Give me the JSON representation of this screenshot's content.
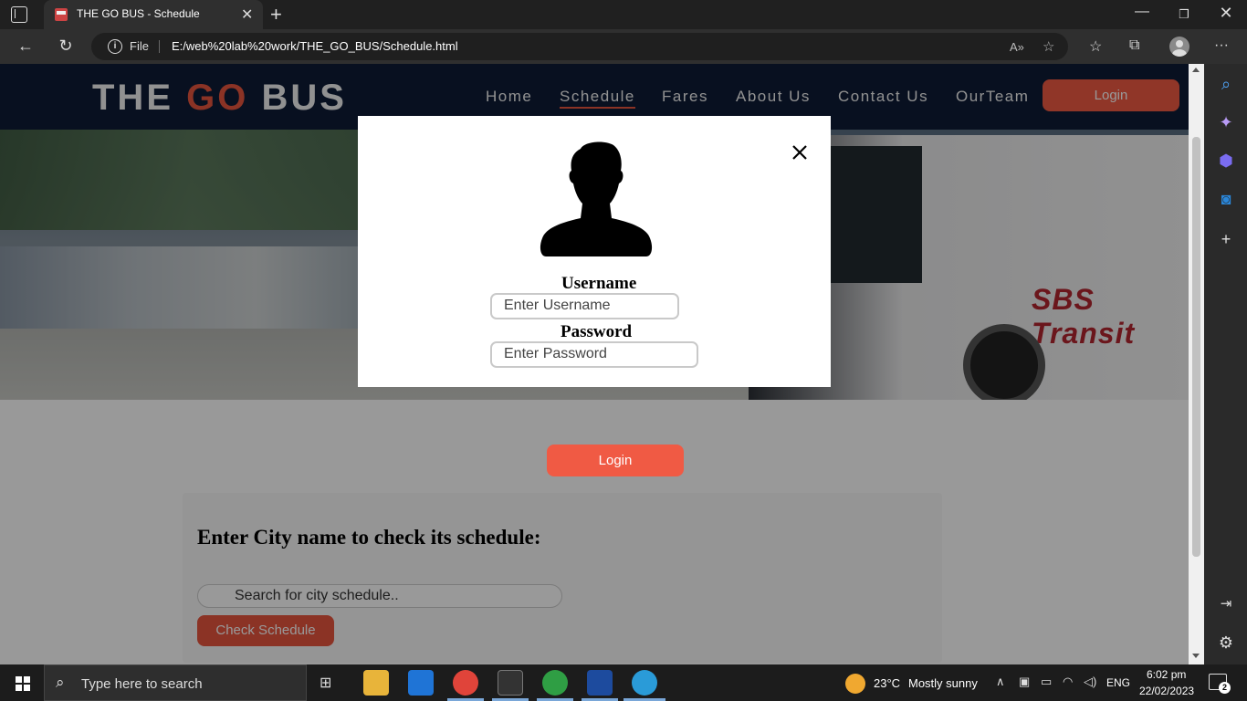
{
  "browser": {
    "tab_title": "THE GO BUS - Schedule",
    "address_scheme": "File",
    "url": "E:/web%20lab%20work/THE_GO_BUS/Schedule.html"
  },
  "site": {
    "logo_part1": "THE",
    "logo_part2": "GO",
    "logo_part3": "BUS",
    "nav": [
      "Home",
      "Schedule",
      "Fares",
      "About Us",
      "Contact Us",
      "OurTeam"
    ],
    "active_nav": "Schedule",
    "login_button": "Login",
    "brand_color": "#e8553f",
    "header_color": "#0e1c36"
  },
  "schedule": {
    "heading": "Enter City name to check its schedule:",
    "search_placeholder": "Search for city schedule..",
    "check_button": "Check Schedule"
  },
  "hero": {
    "bus_sign": "SBS Transit"
  },
  "login_modal": {
    "username_label": "Username",
    "username_placeholder": "Enter Username",
    "password_label": "Password",
    "password_placeholder": "Enter Password",
    "submit": "Login"
  },
  "taskbar": {
    "search_placeholder": "Type here to search",
    "weather_temp": "23°C",
    "weather_desc": "Mostly sunny",
    "language": "ENG",
    "time": "6:02 pm",
    "date": "22/02/2023",
    "notification_count": "2"
  }
}
